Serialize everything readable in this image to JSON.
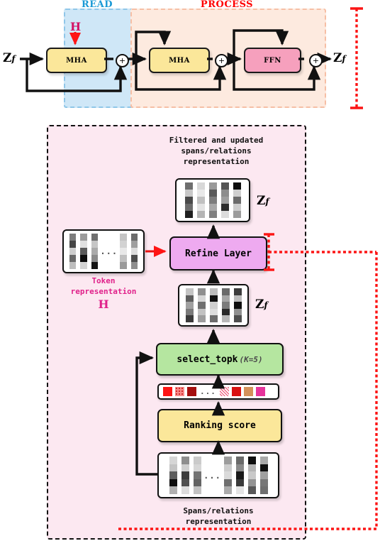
{
  "top_panel": {
    "zones": [
      {
        "name": "read",
        "label": "READ",
        "color": "#1b9ad6"
      },
      {
        "name": "process",
        "label": "PROCESS",
        "color": "#ff0000"
      }
    ],
    "input_label": "Z",
    "input_sub": "f",
    "output_label": "Z",
    "output_sub": "f",
    "token_input_label": "H",
    "blocks": [
      {
        "name": "mha-read",
        "label": "MHA",
        "color": "#fbe79a"
      },
      {
        "name": "mha-process",
        "label": "MHA",
        "color": "#fbe79a"
      },
      {
        "name": "ffn",
        "label": "FFN",
        "color": "#f6a0bd"
      }
    ],
    "operators": [
      "+",
      "+",
      "+"
    ]
  },
  "bottom_panel": {
    "top_caption": "Filtered and updated\nspans/relations\nrepresentation",
    "top_caption_lines": [
      "Filtered and updated",
      "spans/relations",
      "representation"
    ],
    "bottom_caption_lines": [
      "Spans/relations",
      "representation"
    ],
    "token_caption_lines": [
      "Token",
      "representation"
    ],
    "token_symbol": "H",
    "zf_label": "Z",
    "zf_sub": "f",
    "refine_layer": {
      "label": "Refine Layer",
      "color": "#eeaaf0"
    },
    "select_topk": {
      "label": "select_topk",
      "k_label": "(K=5)",
      "color": "#b5e6a0"
    },
    "ranking_score": {
      "label": "Ranking score",
      "color": "#fbe79a"
    },
    "score_swatches": [
      {
        "color": "#fc1414",
        "pattern": "solid"
      },
      {
        "color": "#f98a8a",
        "pattern": "dotted"
      },
      {
        "color": "#a50f0f",
        "pattern": "solid"
      },
      {
        "color": "dots",
        "pattern": "ellipsis"
      },
      {
        "color": "#f06a86",
        "pattern": "checker"
      },
      {
        "color": "#d91111",
        "pattern": "solid"
      },
      {
        "color": "#d4915a",
        "pattern": "solid"
      },
      {
        "color": "#e6339b",
        "pattern": "solid"
      }
    ],
    "accent_red": "#ff1a1a",
    "panel_fill": "#fce8f1"
  },
  "matrices": {
    "zf_top": [
      [
        "#6e6e6e",
        "#d8d8d8",
        "#9a9a9a",
        "#555555",
        "#0d0d0d"
      ],
      [
        "#c8c8c8",
        "#e8e8e8",
        "#5a5a5a",
        "#8d8d8d",
        "#cfcfcf"
      ],
      [
        "#4a4a4a",
        "#c0c0c0",
        "#7d7d7d",
        "#9e9e9e",
        "#6b6b6b"
      ],
      [
        "#6b6b6b",
        "#e3e3e3",
        "#a8a8a8",
        "#2b2b2b",
        "#cdcdcd"
      ],
      [
        "#1f1f1f",
        "#b5b5b5",
        "#808080",
        "#dcdcdc",
        "#9c9c9c"
      ]
    ],
    "zf_mid": [
      [
        "#c4c4c4",
        "#8f8f8f",
        "#bdbdbd",
        "#6a6a6a",
        "#3c3c3c"
      ],
      [
        "#5e5e5e",
        "#d6d6d6",
        "#111111",
        "#a6a6a6",
        "#bcbcbc"
      ],
      [
        "#a0a0a0",
        "#6f6f6f",
        "#cfcfcf",
        "#7b7b7b",
        "#0f0f0f"
      ],
      [
        "#7a7a7a",
        "#c2c2c2",
        "#dddddd",
        "#2a2a2a",
        "#909090"
      ],
      [
        "#3a3a3a",
        "#9d9d9d",
        "#6c6c6c",
        "#b8b8b8",
        "#4e4e4e"
      ]
    ],
    "tokens": [
      [
        "#7d7d7d",
        "#9b9b9b",
        "#6f6f6f",
        "#c4c4c4",
        "#6b6b6b"
      ],
      [
        "#454545",
        "#e0e0e0",
        "#c6c6c6",
        "#d2d2d2",
        "#9f9f9f"
      ],
      [
        "#cfcfcf",
        "#5a5a5a",
        "#aaaaaa",
        "#e8e8e8",
        "#dcdcdc"
      ],
      [
        "#6a6a6a",
        "#0d0d0d",
        "#8b8b8b",
        "#c0c0c0",
        "#4d4d4d"
      ],
      [
        "#bdbdbd",
        "#d4d4d4",
        "#141414",
        "#9a9a9a",
        "#8e8e8e"
      ]
    ],
    "spans": [
      [
        "#d6d6d6",
        "#8e8e8e",
        "#cbcbcb",
        "#9c9c9c",
        "#6a6a6a",
        "#0f0f0f",
        "#a9a9a9"
      ],
      [
        "#c4c4c4",
        "#cfcfcf",
        "#d7d7d7",
        "#cdcdcd",
        "#8b8b8b",
        "#b4b4b4",
        "#101010"
      ],
      [
        "#5e5e5e",
        "#3c3c3c",
        "#747474",
        "#dadada",
        "#1a1a1a",
        "#c9c9c9",
        "#a0a0a0"
      ],
      [
        "#0d0d0d",
        "#4f4f4f",
        "#636363",
        "#6e6e6e",
        "#3a3a3a",
        "#949494",
        "#777777"
      ],
      [
        "#b0b0b0",
        "#dcdcdc",
        "#c2c2c2",
        "#ababab",
        "#e4e4e4",
        "#585858",
        "#6f6f6f"
      ]
    ]
  }
}
